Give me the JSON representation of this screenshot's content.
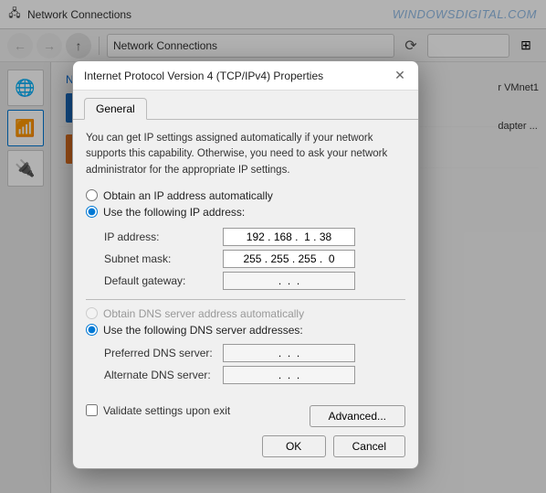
{
  "watermark": "WINDOWSDIGITAL.COM",
  "bg_window": {
    "title": "Network Connections",
    "address": "Network Connections",
    "back_tooltip": "Back",
    "refresh_tooltip": "Refresh",
    "view_toggle_tooltip": "Change your view"
  },
  "dialog": {
    "title": "Internet Protocol Version 4 (TCP/IPv4) Properties",
    "close_label": "✕",
    "tabs": [
      {
        "label": "General",
        "active": true
      }
    ],
    "info_text": "You can get IP settings assigned automatically if your network supports this capability. Otherwise, you need to ask your network administrator for the appropriate IP settings.",
    "radio_auto_ip": "Obtain an IP address automatically",
    "radio_manual_ip": "Use the following IP address:",
    "ip_address_label": "IP address:",
    "ip_address_value": "192 . 168 .  1 . 38",
    "subnet_mask_label": "Subnet mask:",
    "subnet_mask_value": "255 . 255 . 255 .  0",
    "default_gateway_label": "Default gateway:",
    "default_gateway_value": " .  .  . ",
    "radio_auto_dns": "Obtain DNS server address automatically",
    "radio_manual_dns": "Use the following DNS server addresses:",
    "preferred_dns_label": "Preferred DNS server:",
    "preferred_dns_value": " .  .  . ",
    "alternate_dns_label": "Alternate DNS server:",
    "alternate_dns_value": " .  .  . ",
    "validate_checkbox_label": "Validate settings upon exit",
    "advanced_button_label": "Advanced...",
    "ok_button_label": "OK",
    "cancel_button_label": "Cancel"
  },
  "sidebar": {
    "items": [
      {
        "icon": "🌐",
        "name": "network-icon"
      },
      {
        "icon": "📶",
        "name": "wifi-icon"
      },
      {
        "icon": "🔌",
        "name": "ethernet-icon"
      }
    ]
  }
}
